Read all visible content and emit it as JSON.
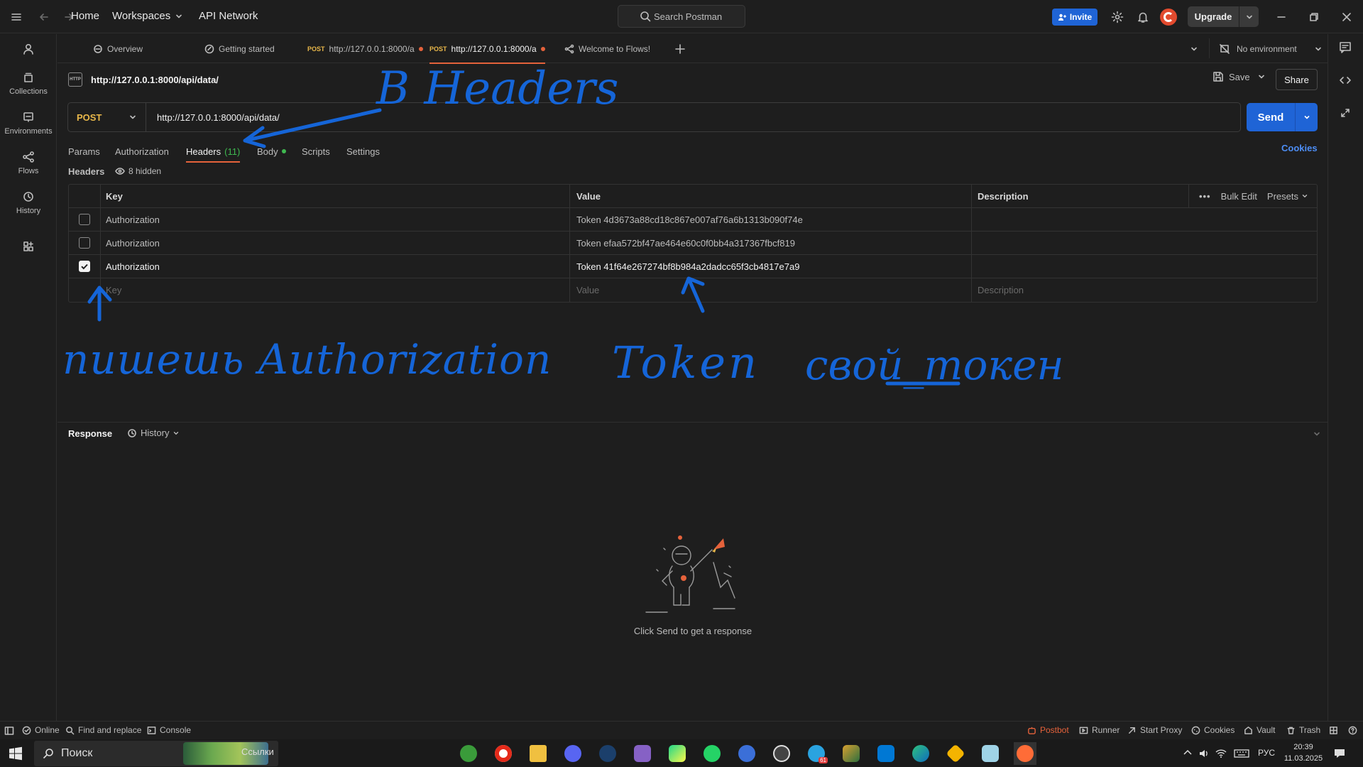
{
  "titlebar": {
    "home": "Home",
    "workspaces": "Workspaces",
    "api_network": "API Network",
    "search_placeholder": "Search Postman",
    "invite": "Invite",
    "upgrade": "Upgrade"
  },
  "sidebar": {
    "items": [
      {
        "label": "Collections",
        "icon": "collections-icon"
      },
      {
        "label": "Environments",
        "icon": "environments-icon"
      },
      {
        "label": "Flows",
        "icon": "flows-icon"
      },
      {
        "label": "History",
        "icon": "history-icon"
      }
    ]
  },
  "tabs": [
    {
      "label": "Overview"
    },
    {
      "label": "Getting started"
    },
    {
      "method": "POST",
      "label": "http://127.0.0.1:8000/a"
    },
    {
      "method": "POST",
      "label": "http://127.0.0.1:8000/a"
    },
    {
      "label": "Welcome to Flows!"
    }
  ],
  "environment": "No environment",
  "request": {
    "name": "http://127.0.0.1:8000/api/data/",
    "method": "POST",
    "url": "http://127.0.0.1:8000/api/data/",
    "save": "Save",
    "share": "Share",
    "send": "Send",
    "cookies": "Cookies",
    "http_badge": "HTTP"
  },
  "request_tabs": {
    "params": "Params",
    "authorization": "Authorization",
    "headers": "Headers",
    "headers_count": "(11)",
    "body": "Body",
    "scripts": "Scripts",
    "settings": "Settings"
  },
  "headers_section": {
    "title": "Headers",
    "hidden": "8 hidden",
    "columns": {
      "key": "Key",
      "value": "Value",
      "description": "Description"
    },
    "bulk_edit": "Bulk Edit",
    "presets": "Presets",
    "rows": [
      {
        "checked": false,
        "key": "Authorization",
        "value": "Token 4d3673a88cd18c867e007af76a6b1313b090f74e"
      },
      {
        "checked": false,
        "key": "Authorization",
        "value": "Token efaa572bf47ae464e60c0f0bb4a317367fbcf819"
      },
      {
        "checked": true,
        "key": "Authorization",
        "value": "Token 41f64e267274bf8b984a2dadcc65f3cb4817e7a9"
      }
    ],
    "placeholders": {
      "key": "Key",
      "value": "Value",
      "description": "Description"
    }
  },
  "annotations": {
    "headers_note": "B Headers",
    "key_note": "пишешь Authorization",
    "token_note_1": "Token",
    "token_note_2": "свой_токен",
    "color": "#1565d8"
  },
  "response": {
    "title": "Response",
    "history": "History",
    "empty_message": "Click Send to get a response"
  },
  "statusbar": {
    "online": "Online",
    "find_replace": "Find and replace",
    "console": "Console",
    "postbot": "Postbot",
    "runner": "Runner",
    "start_proxy": "Start Proxy",
    "cookies": "Cookies",
    "vault": "Vault",
    "trash": "Trash"
  },
  "taskbar": {
    "search": "Поиск",
    "links": "Ссылки",
    "language": "РУС",
    "time": "20:39",
    "date": "11.03.2025",
    "badge": "61"
  },
  "colors": {
    "accent_orange": "#e5623b",
    "primary_blue": "#1f64d6",
    "method_post": "#e9b84a",
    "body_dot": "#3fb950"
  }
}
